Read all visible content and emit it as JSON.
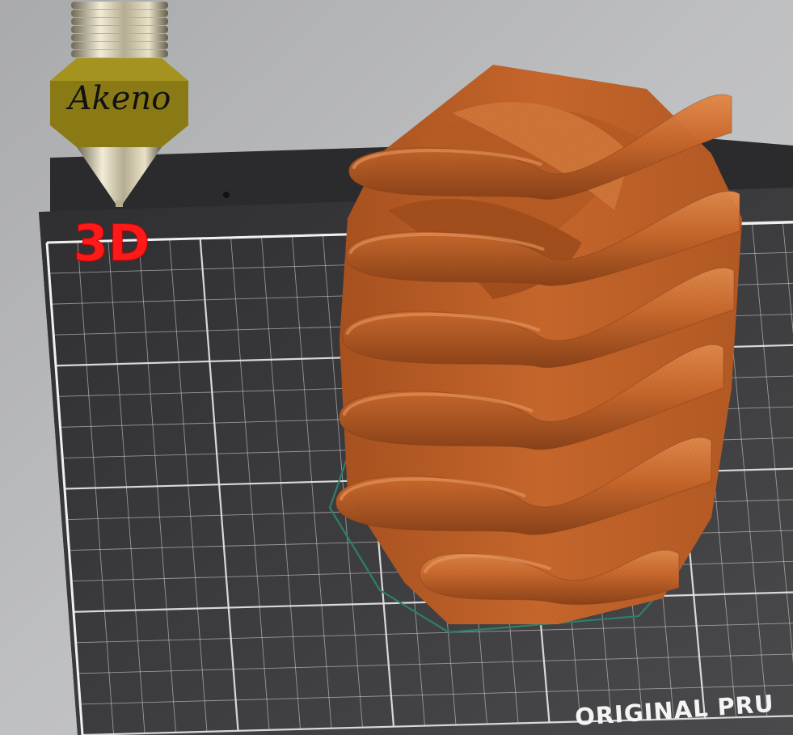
{
  "watermark": {
    "brand": "Akeno",
    "suffix": "3D"
  },
  "bed": {
    "label": "ORIGINAL PRU"
  },
  "colors": {
    "background": "#b8b9bb",
    "bed_surface": "#3a3a3c",
    "grid_line": "#e6e6e6",
    "model_orange": "#c8682c",
    "model_shadow": "#8a4218",
    "model_highlight": "#e08a4c",
    "footprint_outline": "#2f7f6a",
    "logo_gold": "#8a7a16",
    "logo_red": "#ff1a1a"
  },
  "icons": [
    "nozzle-icon"
  ]
}
